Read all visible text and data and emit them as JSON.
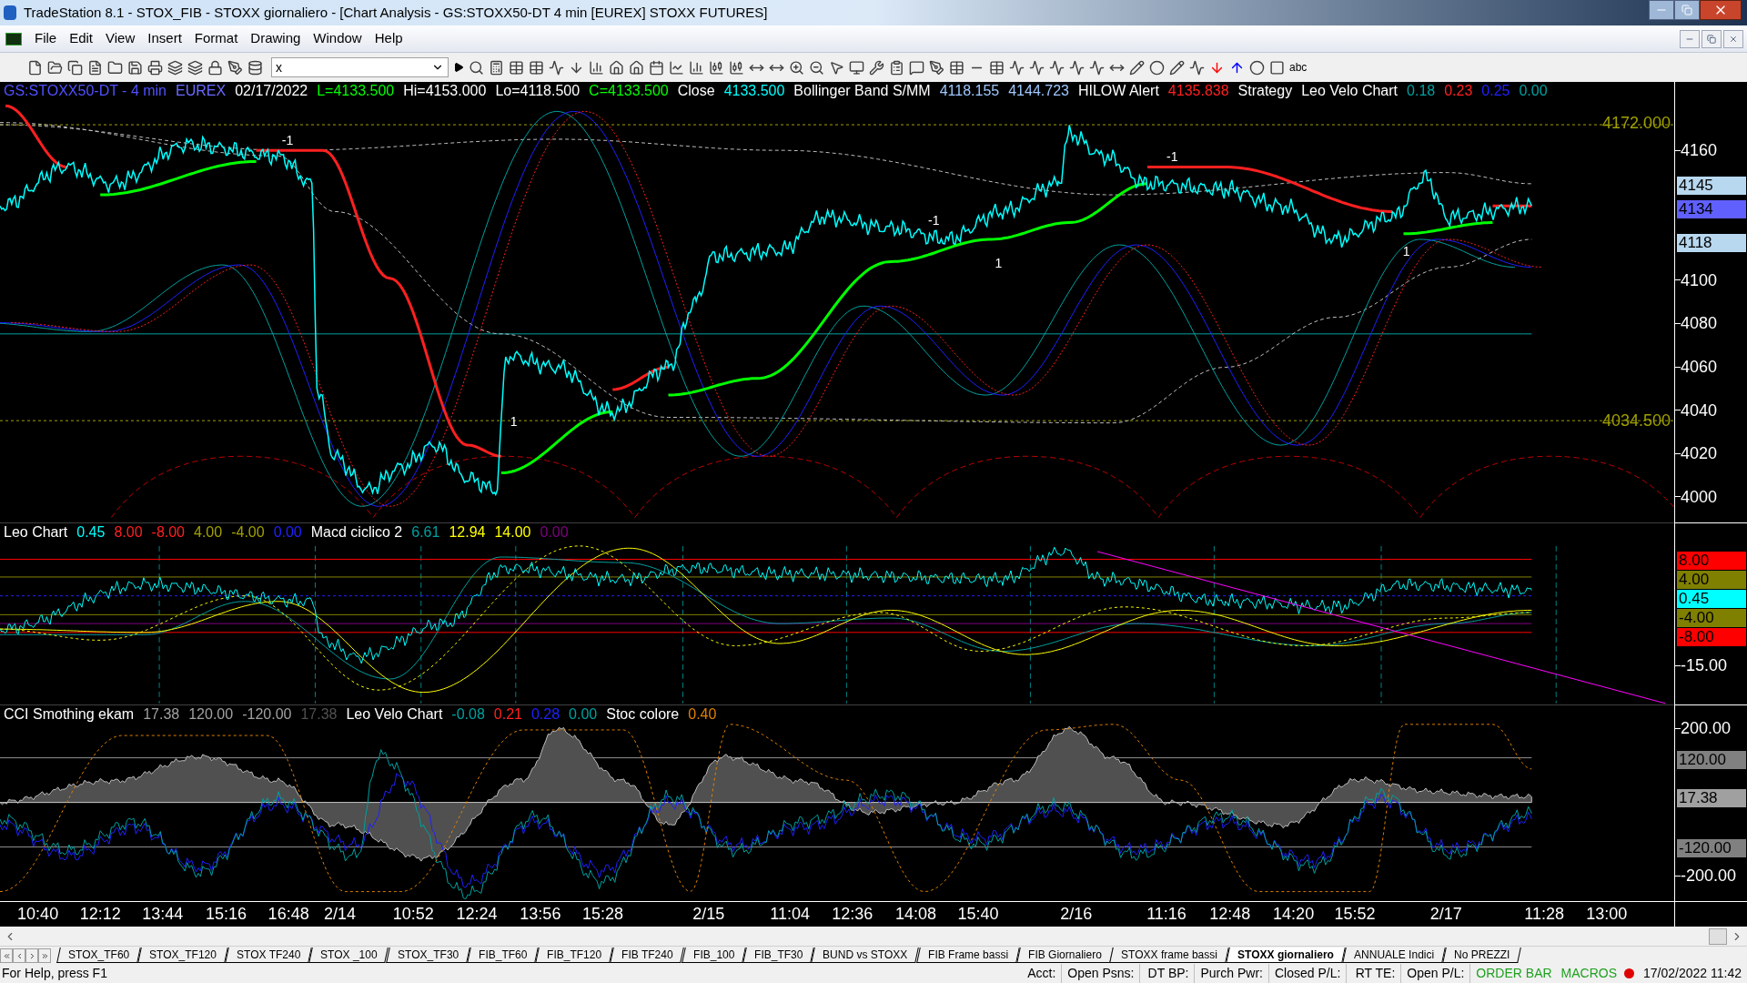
{
  "window": {
    "title": "TradeStation 8.1 - STOX_FIB - STOXX giornaliero - [Chart Analysis - GS:STOXX50-DT  4 min  [EUREX] STOXX FUTURES]"
  },
  "menu": [
    "File",
    "Edit",
    "View",
    "Insert",
    "Format",
    "Drawing",
    "Window",
    "Help"
  ],
  "toolbar": {
    "symbol_field": "x",
    "text_tool": "abc"
  },
  "price_pane": {
    "header": [
      {
        "text": "GS:STOXX50-DT - 4 min",
        "color": "#5050ff"
      },
      {
        "text": "EUREX",
        "color": "#6a6aff"
      },
      {
        "text": "02/17/2022",
        "color": "#ffffff"
      },
      {
        "text": "L=4133.500",
        "color": "#00ff00"
      },
      {
        "text": "Hi=4153.000",
        "color": "#ffffff"
      },
      {
        "text": "Lo=4118.500",
        "color": "#ffffff"
      },
      {
        "text": "C=4133.500",
        "color": "#00ff00"
      },
      {
        "text": "Close",
        "color": "#ffffff"
      },
      {
        "text": "4133.500",
        "color": "#00ffff"
      },
      {
        "text": "Bollinger Band S/MM",
        "color": "#ffffff"
      },
      {
        "text": "4118.155",
        "color": "#9ec8ff"
      },
      {
        "text": "4144.723",
        "color": "#9ec8ff"
      },
      {
        "text": "HILOW Alert",
        "color": "#ffffff"
      },
      {
        "text": "4135.838",
        "color": "#ff2020"
      },
      {
        "text": "Strategy",
        "color": "#ffffff"
      },
      {
        "text": "Leo Velo Chart",
        "color": "#ffffff"
      },
      {
        "text": "0.18",
        "color": "#00a0a0"
      },
      {
        "text": "0.23",
        "color": "#ff2020"
      },
      {
        "text": "0.25",
        "color": "#2020ff"
      },
      {
        "text": "0.00",
        "color": "#00a0a0"
      }
    ],
    "levels": [
      "4172.000",
      "4034.500"
    ],
    "signals": [
      "-1",
      "1",
      "-1",
      "1",
      "-1",
      "1"
    ],
    "ticks": [
      "4160",
      "4100",
      "4080",
      "4060",
      "4040",
      "4020",
      "4000"
    ],
    "badges": [
      {
        "text": "4145",
        "color": "#b8d8f0"
      },
      {
        "text": "4134",
        "color": "#6060ff"
      },
      {
        "text": "4118",
        "color": "#b8d8f0"
      }
    ]
  },
  "leo_pane": {
    "header": [
      {
        "text": "Leo Chart",
        "color": "#ffffff"
      },
      {
        "text": "0.45",
        "color": "#00ffff"
      },
      {
        "text": "8.00",
        "color": "#ff2020"
      },
      {
        "text": "-8.00",
        "color": "#ff2020"
      },
      {
        "text": "4.00",
        "color": "#a0a000"
      },
      {
        "text": "-4.00",
        "color": "#a0a000"
      },
      {
        "text": "0.00",
        "color": "#2020ff"
      },
      {
        "text": "Macd ciclico 2",
        "color": "#ffffff"
      },
      {
        "text": "6.61",
        "color": "#00a0a0"
      },
      {
        "text": "12.94",
        "color": "#ffff00"
      },
      {
        "text": "14.00",
        "color": "#ffff00"
      },
      {
        "text": "0.00",
        "color": "#800080"
      }
    ],
    "badges": [
      {
        "text": "8.00",
        "color": "#ff0000"
      },
      {
        "text": "4.00",
        "color": "#808000"
      },
      {
        "text": "0.45",
        "color": "#00ffff"
      },
      {
        "text": "-4.00",
        "color": "#808000"
      },
      {
        "text": "-8.00",
        "color": "#ff0000"
      }
    ],
    "ticks": [
      "-15.00"
    ]
  },
  "cci_pane": {
    "header": [
      {
        "text": "CCI Smothing ekam",
        "color": "#ffffff"
      },
      {
        "text": "17.38",
        "color": "#a0a0a0"
      },
      {
        "text": "120.00",
        "color": "#a0a0a0"
      },
      {
        "text": "-120.00",
        "color": "#a0a0a0"
      },
      {
        "text": "17.38",
        "color": "#505050"
      },
      {
        "text": "Leo Velo Chart",
        "color": "#ffffff"
      },
      {
        "text": "-0.08",
        "color": "#00a0a0"
      },
      {
        "text": "0.21",
        "color": "#ff2020"
      },
      {
        "text": "0.28",
        "color": "#2020ff"
      },
      {
        "text": "0.00",
        "color": "#00a0a0"
      },
      {
        "text": "Stoc colore",
        "color": "#ffffff"
      },
      {
        "text": "0.40",
        "color": "#e08000"
      }
    ],
    "ticks": [
      "200.00",
      "-200.00"
    ],
    "badges": [
      {
        "text": "120.00",
        "color": "#808080"
      },
      {
        "text": "17.38",
        "color": "#a0a0a0"
      },
      {
        "text": "-120.00",
        "color": "#808080"
      }
    ]
  },
  "time_axis": [
    "10:40",
    "12:12",
    "13:44",
    "15:16",
    "16:48",
    "2/14",
    "10:52",
    "12:24",
    "13:56",
    "15:28",
    "2/15",
    "11:04",
    "12:36",
    "14:08",
    "15:40",
    "2/16",
    "11:16",
    "12:48",
    "14:20",
    "15:52",
    "2/17",
    "11:28",
    "13:00"
  ],
  "tabs": [
    {
      "label": "STOX_TF60",
      "selected": false
    },
    {
      "label": "STOX_TF120",
      "selected": false
    },
    {
      "label": "STOX TF240",
      "selected": false
    },
    {
      "label": "STOX _100",
      "selected": false
    },
    {
      "label": "STOX_TF30",
      "selected": false
    },
    {
      "label": "FIB_TF60",
      "selected": false
    },
    {
      "label": "FIB_TF120",
      "selected": false
    },
    {
      "label": "FIB TF240",
      "selected": false
    },
    {
      "label": "FIB_100",
      "selected": false
    },
    {
      "label": "FIB_TF30",
      "selected": false
    },
    {
      "label": "BUND vs STOXX",
      "selected": false
    },
    {
      "label": "FIB Frame bassi",
      "selected": false
    },
    {
      "label": "FIB Giornaliero",
      "selected": false
    },
    {
      "label": "STOXX frame bassi",
      "selected": false
    },
    {
      "label": "STOXX giornaliero",
      "selected": true
    },
    {
      "label": "ANNUALE Indici",
      "selected": false
    },
    {
      "label": "No PREZZI",
      "selected": false
    }
  ],
  "status_bar": {
    "help": "For Help, press F1",
    "fields": [
      "Acct:",
      "Open Psns:",
      "DT BP:",
      "Purch Pwr:",
      "Closed P/L:",
      "RT TE:",
      "Open P/L:"
    ],
    "order_bar": "ORDER BAR",
    "macros": "MACROS",
    "datetime": "17/02/2022 11:42"
  }
}
